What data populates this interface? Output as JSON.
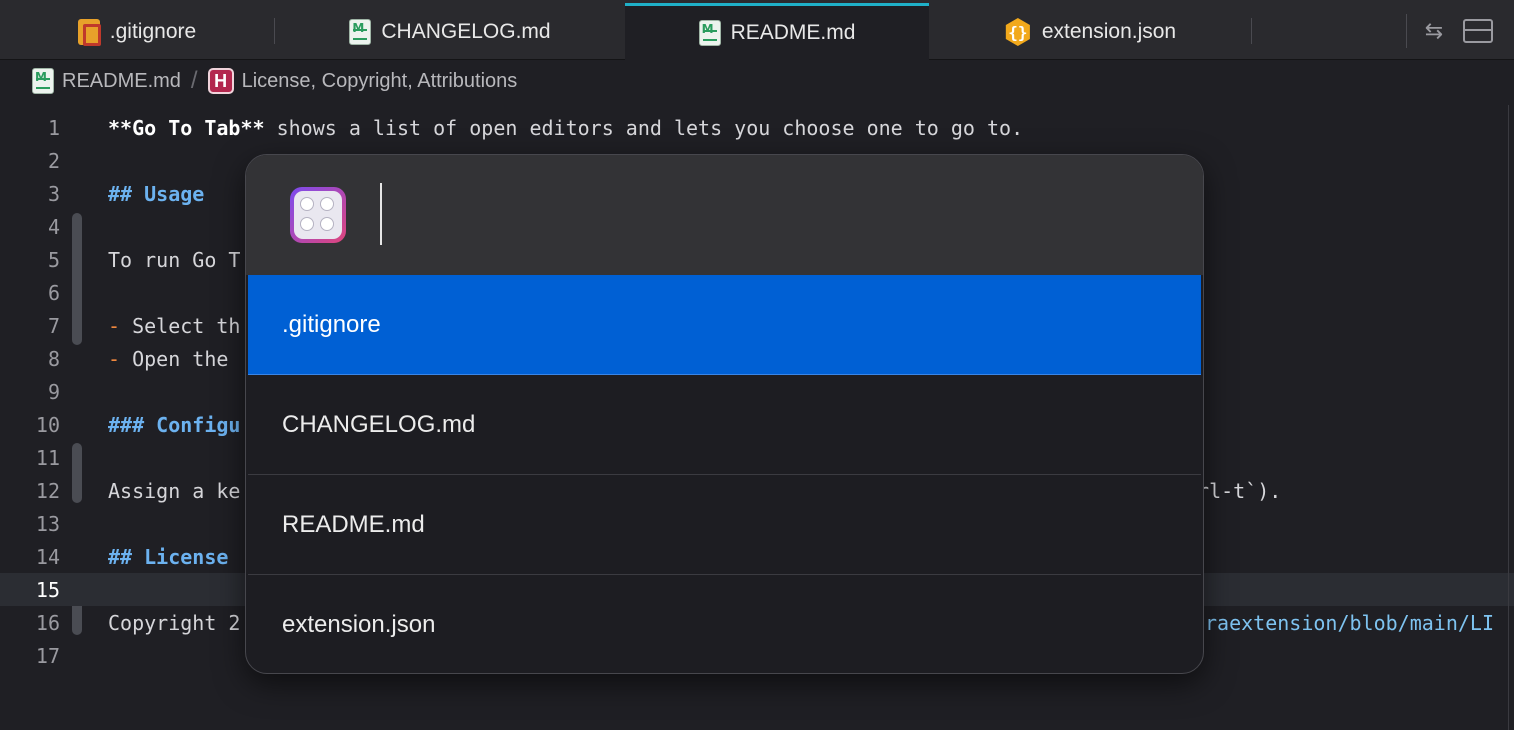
{
  "tabs": [
    {
      "label": ".gitignore",
      "icon": "git-file-icon",
      "active": false
    },
    {
      "label": "CHANGELOG.md",
      "icon": "markdown-file-icon",
      "active": false
    },
    {
      "label": "README.md",
      "icon": "markdown-file-icon",
      "active": true
    },
    {
      "label": "extension.json",
      "icon": "json-file-icon",
      "active": false
    }
  ],
  "json_glyph": "{}",
  "window_controls": {
    "swap_glyph": "⇆"
  },
  "breadcrumb": {
    "file": "README.md",
    "separator": "/",
    "section_badge": "H",
    "section": "License, Copyright, Attributions"
  },
  "editor": {
    "current_line": 15,
    "lines": [
      {
        "n": "1"
      },
      {
        "n": "2"
      },
      {
        "n": "3"
      },
      {
        "n": "4"
      },
      {
        "n": "5"
      },
      {
        "n": "6"
      },
      {
        "n": "7"
      },
      {
        "n": "8"
      },
      {
        "n": "9"
      },
      {
        "n": "10"
      },
      {
        "n": "11"
      },
      {
        "n": "12"
      },
      {
        "n": "13"
      },
      {
        "n": "14"
      },
      {
        "n": "15"
      },
      {
        "n": "16"
      },
      {
        "n": "17"
      }
    ],
    "text": {
      "l1_bold": "**Go To Tab**",
      "l1_rest": " shows a list of open editors and lets you choose one to go to.",
      "l3": "## Usage",
      "l5": "To run Go T",
      "l7_dash": "-",
      "l7_rest": " Select th",
      "l8_dash": "-",
      "l8_rest": " Open the",
      "l10": "### Configu",
      "l12_left": "Assign a ke",
      "l12_right": "trl-t`).",
      "l14": "## License",
      "l16_left": "Copyright 2",
      "l16_right": "raextension/blob/main/LI"
    }
  },
  "palette": {
    "input_value": "",
    "input_placeholder": "",
    "items": [
      {
        "label": ".gitignore",
        "selected": true
      },
      {
        "label": "CHANGELOG.md",
        "selected": false
      },
      {
        "label": "README.md",
        "selected": false
      },
      {
        "label": "extension.json",
        "selected": false
      }
    ]
  },
  "colors": {
    "accent_tab": "#1fb0c8",
    "selection": "#0060d4",
    "heading": "#6cb2f0",
    "list_marker": "#f0883e",
    "link": "#7ec3f0"
  }
}
